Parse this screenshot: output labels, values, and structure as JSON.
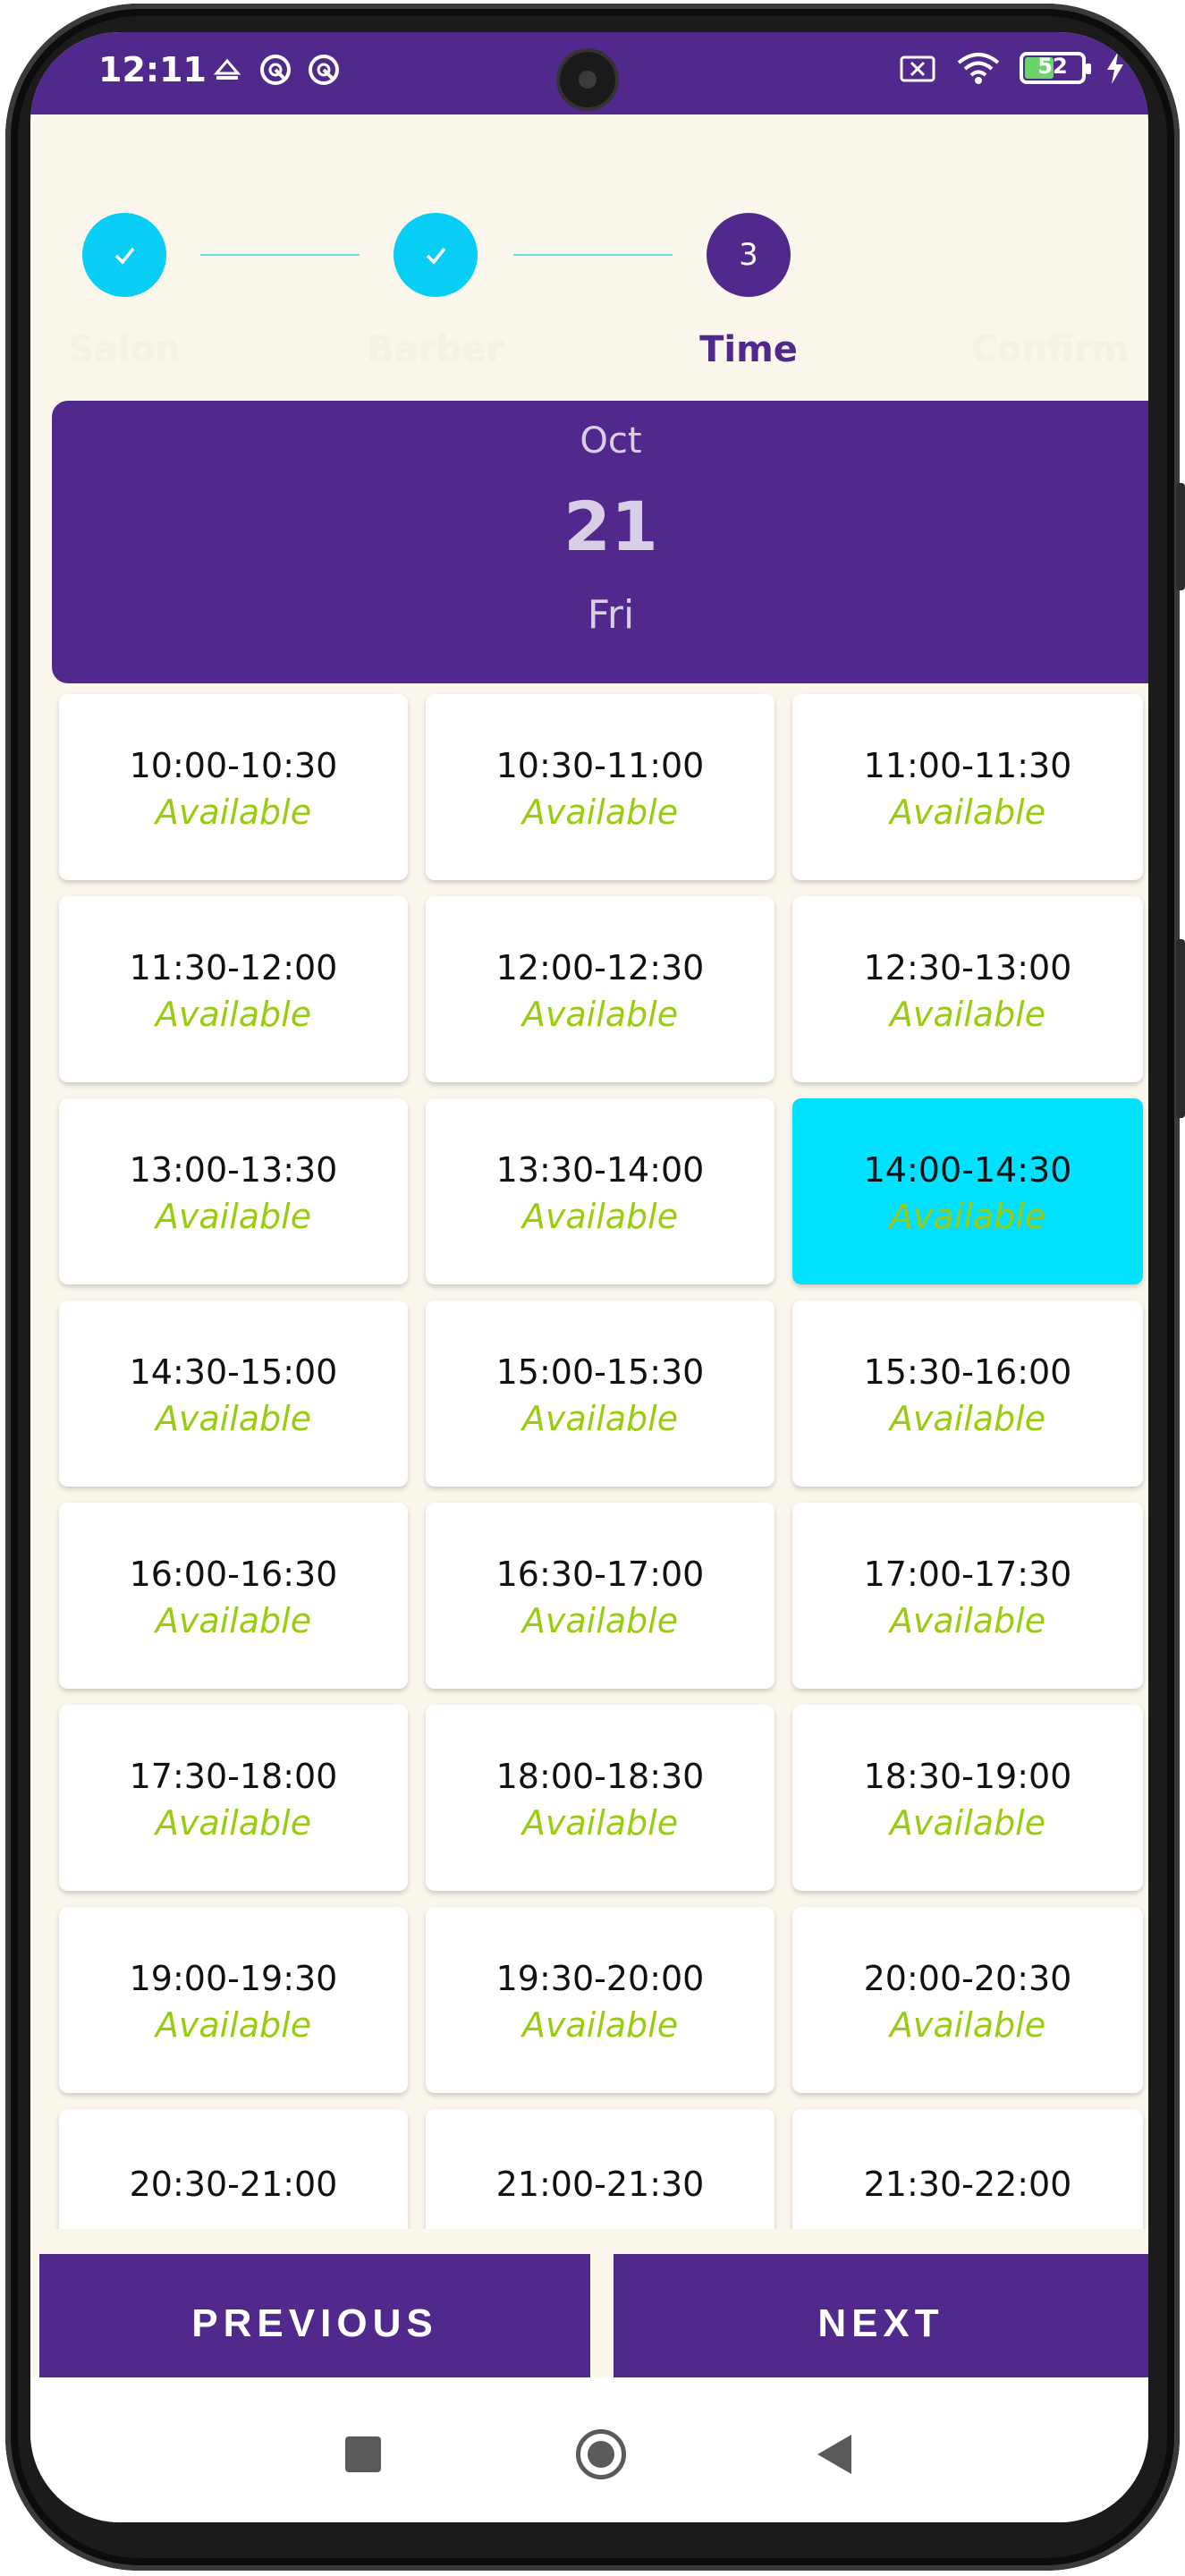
{
  "status_bar": {
    "time": "12:11",
    "battery_level": "52",
    "battery_fraction": 0.52,
    "left_icons": [
      "notification-app-icon",
      "sync-icon",
      "sync-icon"
    ],
    "right_icons": [
      "no-sim-icon",
      "wifi-icon",
      "battery-icon",
      "charging-icon"
    ]
  },
  "stepper": {
    "steps": [
      {
        "label": "Salon",
        "state": "done"
      },
      {
        "label": "Barber",
        "state": "done"
      },
      {
        "label": "Time",
        "state": "active",
        "number": "3"
      },
      {
        "label": "Confirm",
        "state": "pending"
      }
    ]
  },
  "date": {
    "month": "Oct",
    "day": "21",
    "weekday": "Fri"
  },
  "slots": [
    {
      "time": "10:00-10:30",
      "status": "Available",
      "selected": false
    },
    {
      "time": "10:30-11:00",
      "status": "Available",
      "selected": false
    },
    {
      "time": "11:00-11:30",
      "status": "Available",
      "selected": false
    },
    {
      "time": "11:30-12:00",
      "status": "Available",
      "selected": false
    },
    {
      "time": "12:00-12:30",
      "status": "Available",
      "selected": false
    },
    {
      "time": "12:30-13:00",
      "status": "Available",
      "selected": false
    },
    {
      "time": "13:00-13:30",
      "status": "Available",
      "selected": false
    },
    {
      "time": "13:30-14:00",
      "status": "Available",
      "selected": false
    },
    {
      "time": "14:00-14:30",
      "status": "Available",
      "selected": true
    },
    {
      "time": "14:30-15:00",
      "status": "Available",
      "selected": false
    },
    {
      "time": "15:00-15:30",
      "status": "Available",
      "selected": false
    },
    {
      "time": "15:30-16:00",
      "status": "Available",
      "selected": false
    },
    {
      "time": "16:00-16:30",
      "status": "Available",
      "selected": false
    },
    {
      "time": "16:30-17:00",
      "status": "Available",
      "selected": false
    },
    {
      "time": "17:00-17:30",
      "status": "Available",
      "selected": false
    },
    {
      "time": "17:30-18:00",
      "status": "Available",
      "selected": false
    },
    {
      "time": "18:00-18:30",
      "status": "Available",
      "selected": false
    },
    {
      "time": "18:30-19:00",
      "status": "Available",
      "selected": false
    },
    {
      "time": "19:00-19:30",
      "status": "Available",
      "selected": false
    },
    {
      "time": "19:30-20:00",
      "status": "Available",
      "selected": false
    },
    {
      "time": "20:00-20:30",
      "status": "Available",
      "selected": false
    },
    {
      "time": "20:30-21:00",
      "status": "",
      "selected": false
    },
    {
      "time": "21:00-21:30",
      "status": "",
      "selected": false
    },
    {
      "time": "21:30-22:00",
      "status": "",
      "selected": false
    }
  ],
  "buttons": {
    "previous": "PREVIOUS",
    "next": "NEXT"
  },
  "system_nav": {
    "icons": [
      "recents-icon",
      "home-icon",
      "back-icon"
    ]
  },
  "colors": {
    "primary": "#51298c",
    "accent": "#08cdf5",
    "available": "#99cc11",
    "selected_slot": "#00e0ff",
    "background": "#fbf7ed"
  }
}
